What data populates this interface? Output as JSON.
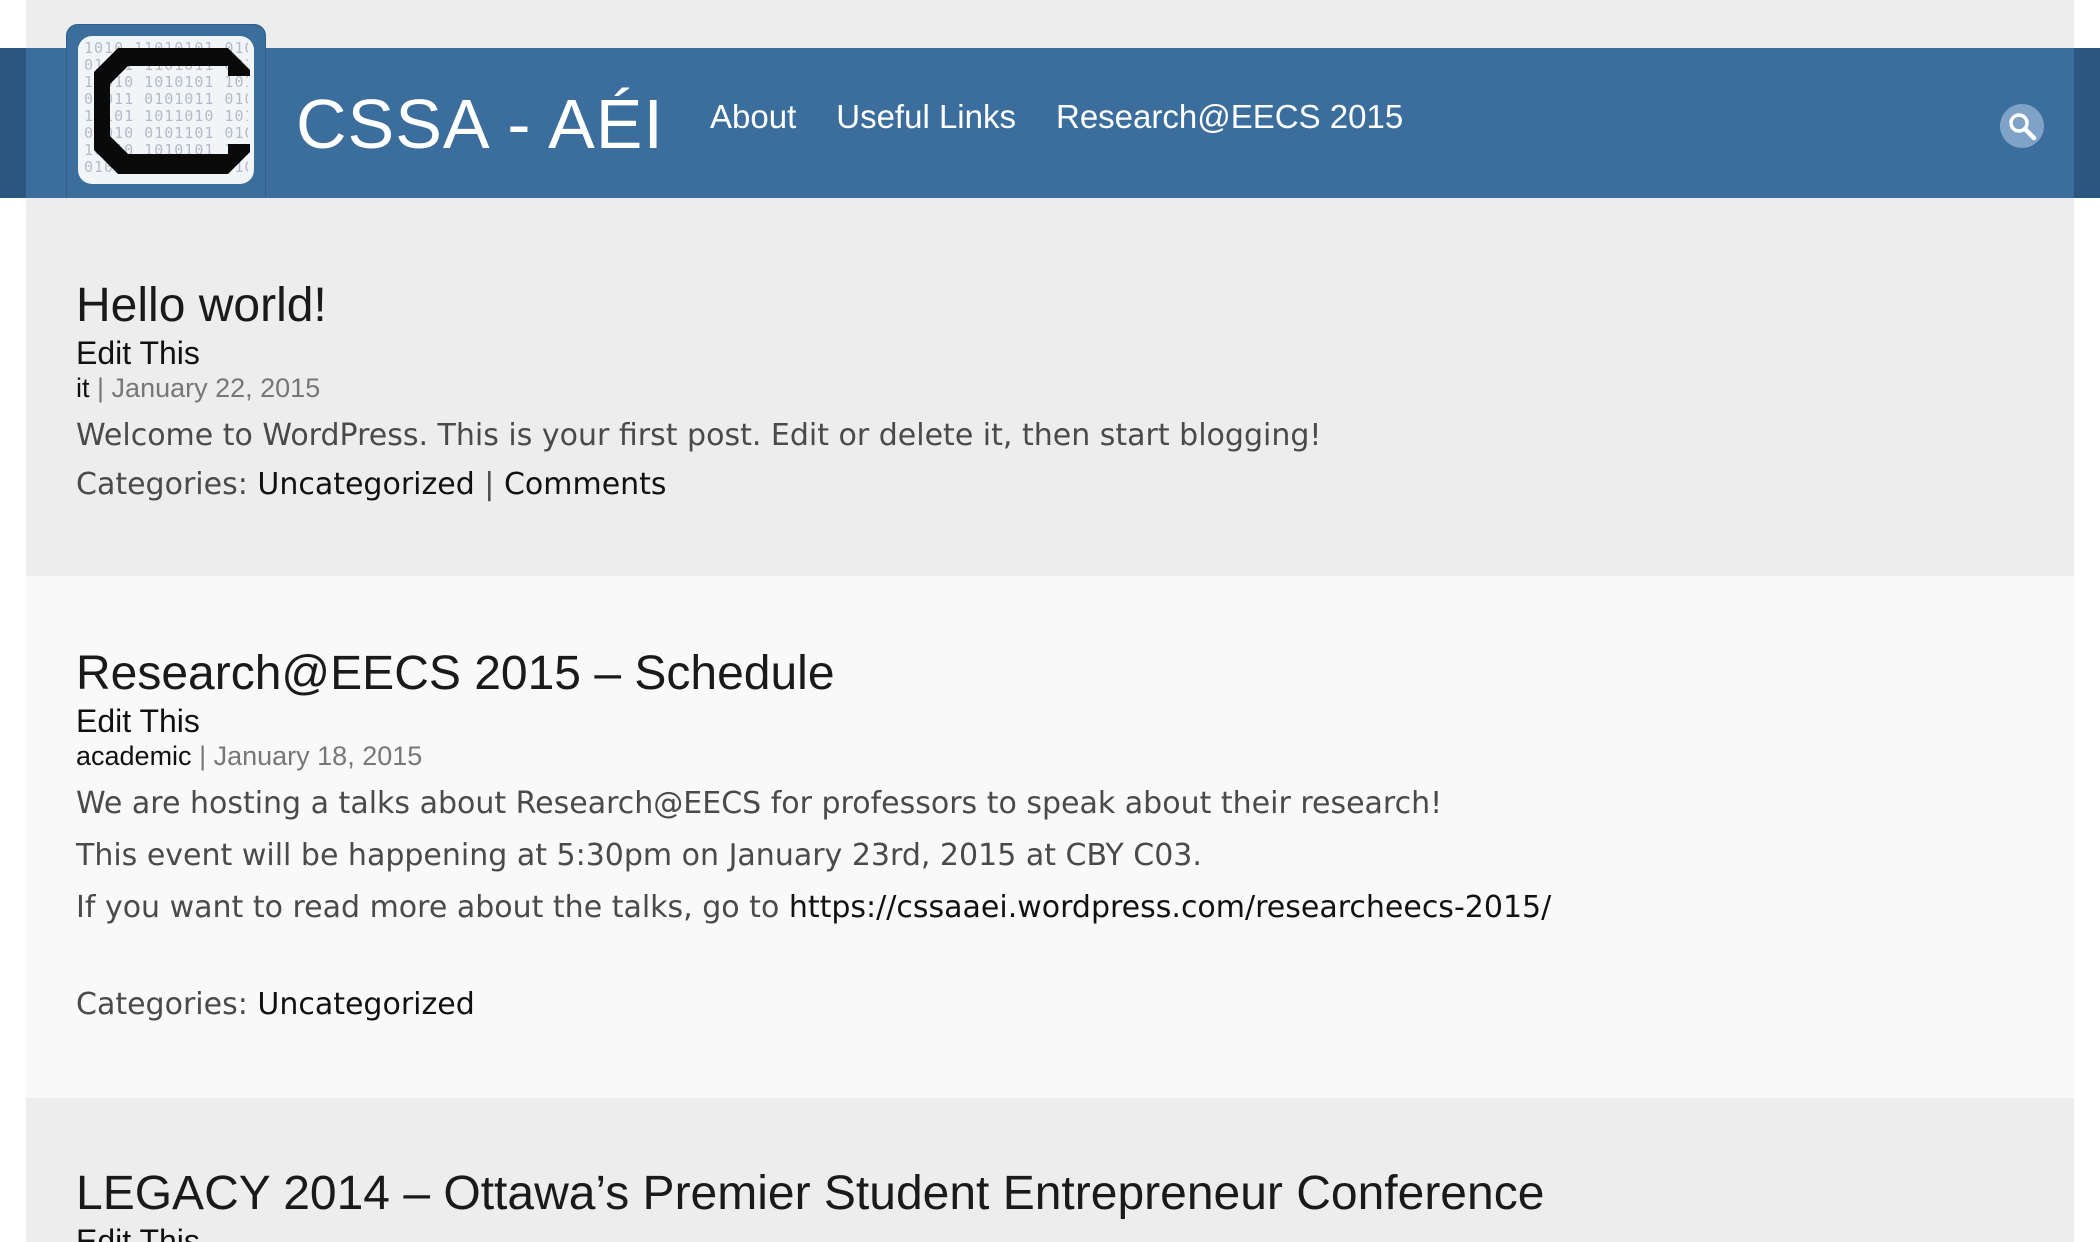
{
  "site": {
    "title": "CSSA - AÉI"
  },
  "nav": {
    "items": [
      {
        "label": "About"
      },
      {
        "label": "Useful Links"
      },
      {
        "label": "Research@EECS 2015"
      }
    ]
  },
  "search": {
    "icon": "search-icon"
  },
  "logo": {
    "icon": "logo-c-icon",
    "binary": "1010 11010101 01010\n01011 1101011 00101\n10010 1010101 10110\n01011 0101011 01011\n10101 1011010 10101\n01010 0101101 01010\n10110 1010101 10110\n01011 0101011 01011"
  },
  "posts": [
    {
      "title": "Hello world!",
      "edit": "Edit This",
      "author": "it",
      "separator": "|",
      "date": "January 22, 2015",
      "body": [
        "Welcome to WordPress. This is your first post. Edit or delete it, then start blogging!"
      ],
      "categories_label": "Categories:",
      "category": "Uncategorized",
      "cat_sep": "|",
      "comments": "Comments"
    },
    {
      "title": "Research@EECS 2015 – Schedule",
      "edit": "Edit This",
      "author": "academic",
      "separator": "|",
      "date": "January 18, 2015",
      "body": [
        "We are hosting a talks about Research@EECS for professors to speak about their research!",
        "This event will be happening at 5:30pm on January 23rd, 2015 at CBY C03."
      ],
      "link_prefix": "If you want to read more about the talks, go to ",
      "link_text": "https://cssaaei.wordpress.com/researcheecs-2015/",
      "categories_label": "Categories:",
      "category": "Uncategorized"
    },
    {
      "title": "LEGACY 2014 – Ottawa’s Premier Student Entrepreneur Conference",
      "edit": "Edit This"
    }
  ]
}
